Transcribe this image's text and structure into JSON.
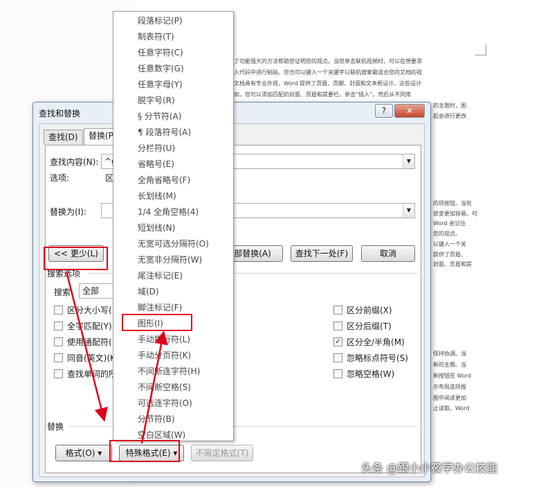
{
  "background_document": {
    "lines": [
      "供了功能强大的方法帮助您证明您的观点。当您单击联机视频时，可以在想要添",
      "嵌入代码中进行粘贴。您也可以键入一个关键字以联机搜索最适合您的文档的视",
      "的文档具有专业外观，Word 提供了页眉、页脚、封面和文本框设计，这些设计",
      "例如，您可以添加匹配的封面、页眉和提要栏。单击“插入”，然后从不同库",
      "的主题时，图",
      "起会进行更改",
      "",
      "的项按钮。当处",
      "就变更加容易。可",
      "Word 会记住",
      "您的观点。",
      "以键入一个关",
      "提供了页眉、",
      "封面、页眉和提",
      "",
      "保持协调。当",
      "新的主题。当",
      "新按钮在 Word",
      "示布局选项按",
      "图中阅读更加",
      "止读取。Word"
    ]
  },
  "dialog": {
    "title": "查找和替换",
    "help": "?",
    "close": "✕",
    "tabs": [
      "查找(D)",
      "替换(P)"
    ],
    "find_label": "查找内容(N):",
    "find_value": "^g",
    "options_label": "选项:",
    "options_value": "区",
    "replace_label": "替换为(I):",
    "replace_value": "",
    "less_button": "<< 更少(L)",
    "replace_all_button": "部替换(A)",
    "find_next_button": "查找下一处(F)",
    "cancel_button": "取消",
    "search_options_title": "搜索选项",
    "search_label": "搜索:",
    "search_value": "全部",
    "left_options": [
      "区分大小写(",
      "全字匹配(Y)",
      "使用通配符(",
      "同音(英文)(K",
      "查找单词的所"
    ],
    "right_options": [
      {
        "label": "区分前缀(X)",
        "checked": false
      },
      {
        "label": "区分后缀(T)",
        "checked": false
      },
      {
        "label": "区分全/半角(M)",
        "checked": true
      },
      {
        "label": "忽略标点符号(S)",
        "checked": false
      },
      {
        "label": "忽略空格(W)",
        "checked": false
      }
    ],
    "replace_section_title": "替换",
    "format_button": "格式(O) ▾",
    "special_button": "特殊格式(E) ▾",
    "no_format_button": "不限定格式(T)"
  },
  "special_menu": {
    "items": [
      "段落标记(P)",
      "制表符(T)",
      "任意字符(C)",
      "任意数字(G)",
      "任意字母(Y)",
      "脱字号(R)",
      "§ 分节符(A)",
      "¶ 段落符号(A)",
      "分栏符(U)",
      "省略号(E)",
      "全角省略号(F)",
      "长划线(M)",
      "1/4 全角空格(4)",
      "短划线(N)",
      "无宽可选分隔符(O)",
      "无宽非分隔符(W)",
      "尾注标记(E)",
      "域(D)",
      "脚注标记(F)",
      "图形(I)",
      "手动换行符(L)",
      "手动分页符(K)",
      "不间断连字符(H)",
      "不间断空格(S)",
      "可选连字符(O)",
      "分节符(B)",
      "空白区域(W)"
    ]
  },
  "watermark": "头条 @跟小小筱学办公技能",
  "colors": {
    "annotation_red": "#e0001b",
    "dialog_frame": "#e9eff7"
  }
}
